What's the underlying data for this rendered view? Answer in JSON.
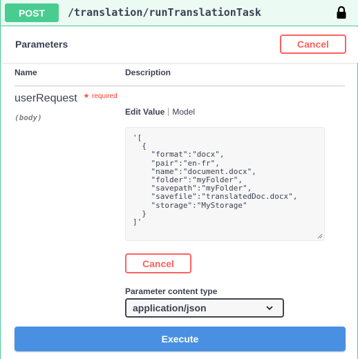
{
  "operation": {
    "method": "POST",
    "path": "/translation/runTranslationTask"
  },
  "parameters": {
    "title": "Parameters",
    "cancel_label": "Cancel",
    "columns": {
      "name": "Name",
      "description": "Description"
    },
    "param": {
      "name": "userRequest",
      "required_mark": "*",
      "required_label": "required",
      "location": "(body)"
    },
    "tabs": {
      "edit_value": "Edit Value",
      "model": "Model"
    },
    "body_value": "'[\n  {\n    \"format\":\"docx\",\n    \"pair\":\"en-fr\",\n    \"name\":\"document.docx\",\n    \"folder\":\"myFolder\",\n    \"savepath\":\"myFolder\",\n    \"savefile\":\"translatedDoc.docx\",\n    \"storage\":\"MyStorage\"\n  }\n]'",
    "cancel_label_2": "Cancel",
    "content_type_label": "Parameter content type",
    "content_type_value": "application/json"
  },
  "execute_label": "Execute",
  "colors": {
    "post": "#49cc90",
    "post_bg": "#ecfaf4",
    "cancel": "#ff6060",
    "execute": "#4990e2",
    "required": "#ff3b30"
  }
}
